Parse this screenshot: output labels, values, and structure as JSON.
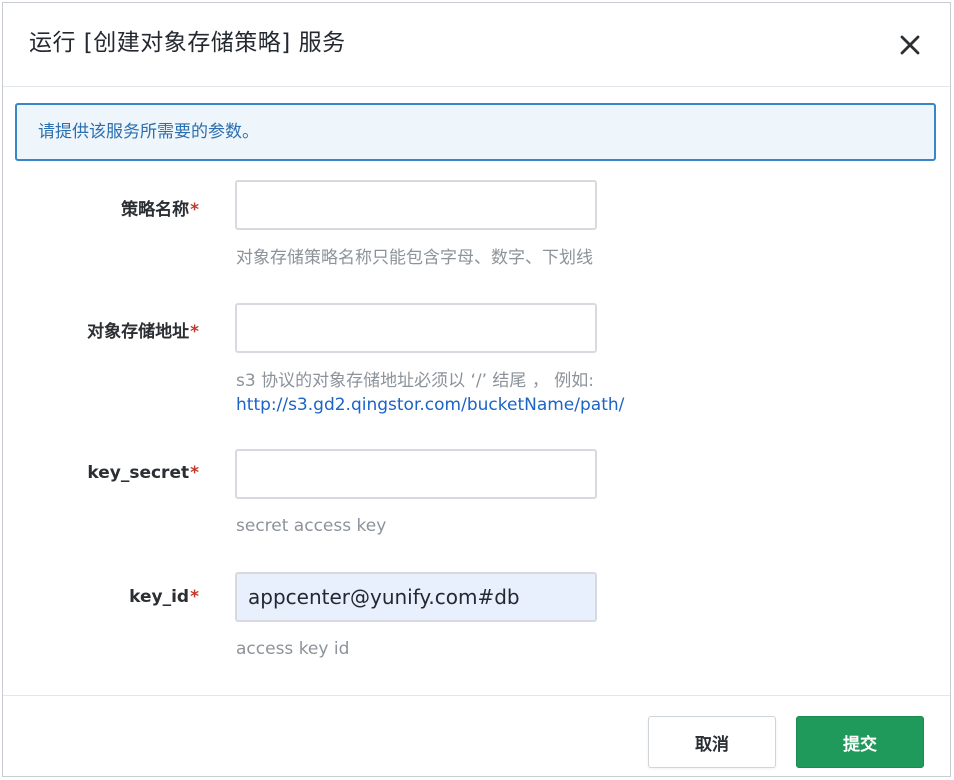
{
  "dialog": {
    "title": "运行 [创建对象存储策略] 服务",
    "close_icon": "close-icon"
  },
  "notice": {
    "text": "请提供该服务所需要的参数。"
  },
  "fields": [
    {
      "label": "策略名称",
      "required_mark": "*",
      "value": "",
      "placeholder": "",
      "hint": "对象存储策略名称只能包含字母、数字、下划线"
    },
    {
      "label": "对象存储地址",
      "required_mark": "*",
      "value": "",
      "placeholder": "",
      "hint": "s3 协议的对象存储地址必须以 ‘/’ 结尾 ， 例如:",
      "hint_link": "http://s3.gd2.qingstor.com/bucketName/path/"
    },
    {
      "label": "key_secret",
      "required_mark": "*",
      "value": "",
      "placeholder": "",
      "hint": "secret access key"
    },
    {
      "label": "key_id",
      "required_mark": "*",
      "value": "appcenter@yunify.com#db",
      "placeholder": "",
      "hint": "access key id"
    }
  ],
  "footer": {
    "cancel_label": "取消",
    "submit_label": "提交"
  },
  "colors": {
    "accent": "#3a86c8",
    "submit": "#1f9a5b",
    "required": "#c0392b",
    "link": "#1b63c5"
  }
}
